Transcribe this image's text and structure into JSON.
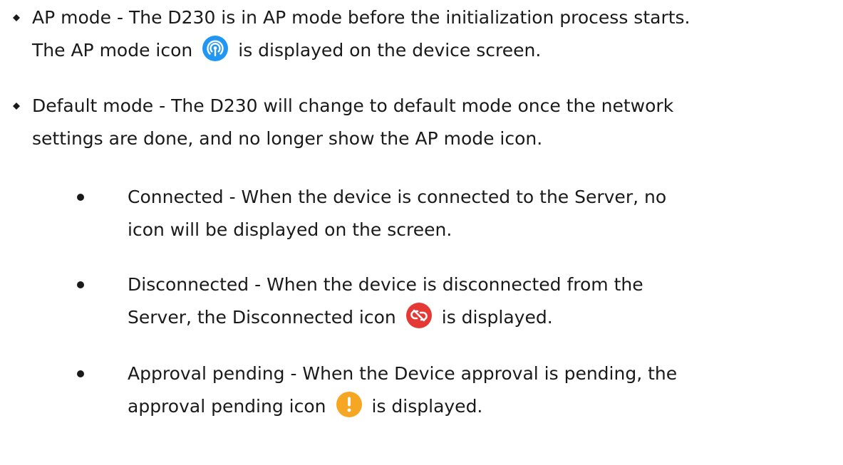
{
  "items": [
    {
      "label": "AP mode",
      "sep": " - ",
      "line1": "The D230 is in AP mode before the initialization process starts.",
      "line2_pre": "The AP mode icon",
      "line2_post": "is displayed on the device screen.",
      "icon": "ap-mode-icon",
      "icon_color": "#2196f3"
    },
    {
      "label": "Default mode",
      "sep": " - ",
      "line1": "The D230 will change to default mode once the network",
      "line2": "settings are done, and no longer show the AP mode icon."
    }
  ],
  "subitems": [
    {
      "label": "Connected",
      "sep": " - ",
      "line1": "When the device is connected to the Server, no",
      "line2": "icon will be displayed on the screen."
    },
    {
      "label": "Disconnected",
      "sep": " - ",
      "line1": "When the device is disconnected from the",
      "line2_pre": "Server, the Disconnected icon",
      "line2_post": "is displayed.",
      "icon": "disconnected-icon",
      "icon_color": "#e53935"
    },
    {
      "label": "Approval pending",
      "sep": " - ",
      "line1": "When the Device approval is pending, the",
      "line2_pre": "approval pending icon",
      "line2_post": "is displayed.",
      "icon": "approval-pending-icon",
      "icon_color": "#f5a623"
    }
  ]
}
